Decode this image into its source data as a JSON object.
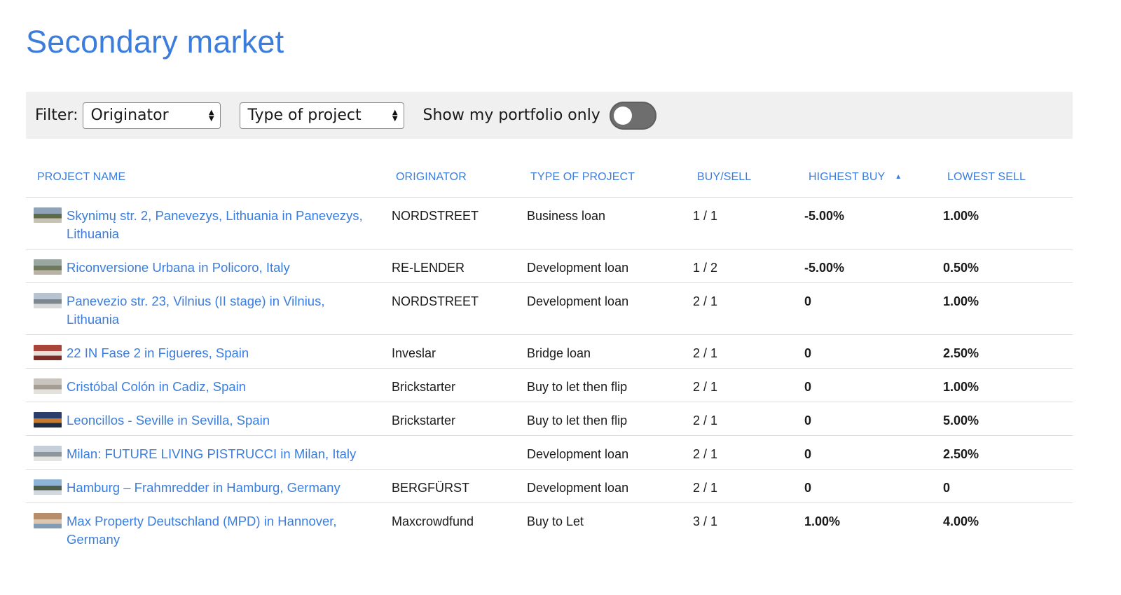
{
  "page": {
    "title": "Secondary market"
  },
  "filters": {
    "label": "Filter:",
    "originator": "Originator",
    "type_of_project": "Type of project",
    "portfolio_label": "Show my portfolio only",
    "portfolio_only": false
  },
  "table": {
    "columns": [
      "PROJECT NAME",
      "ORIGINATOR",
      "TYPE OF PROJECT",
      "BUY/SELL",
      "HIGHEST BUY",
      "LOWEST SELL"
    ],
    "sorted_by": "HIGHEST BUY",
    "rows": [
      {
        "name": "Skynimų str. 2, Panevezys, Lithuania in Panevezys, Lithuania",
        "originator": "NORDSTREET",
        "type": "Business loan",
        "buy_sell": "1 / 1",
        "highest_buy": "-5.00%",
        "lowest_sell": "1.00%",
        "thumb_colors": [
          "#8fa3b8",
          "#5d6b4a",
          "#c9c2b3"
        ]
      },
      {
        "name": "Riconversione Urbana in Policoro, Italy",
        "originator": "RE-LENDER",
        "type": "Development loan",
        "buy_sell": "1 / 2",
        "highest_buy": "-5.00%",
        "lowest_sell": "0.50%",
        "thumb_colors": [
          "#9aa7a0",
          "#6f7a5c",
          "#b9b3a4"
        ]
      },
      {
        "name": "Panevezio str. 23, Vilnius (II stage) in Vilnius, Lithuania",
        "originator": "NORDSTREET",
        "type": "Development loan",
        "buy_sell": "2 / 1",
        "highest_buy": "0",
        "lowest_sell": "1.00%",
        "thumb_colors": [
          "#b7c3cf",
          "#7d8790",
          "#d8d8d8"
        ]
      },
      {
        "name": "22 IN Fase 2 in Figueres, Spain",
        "originator": "Inveslar",
        "type": "Bridge loan",
        "buy_sell": "2 / 1",
        "highest_buy": "0",
        "lowest_sell": "2.50%",
        "thumb_colors": [
          "#a8443a",
          "#e6e0d8",
          "#7a2c25"
        ]
      },
      {
        "name": "Cristóbal Colón in Cadiz, Spain",
        "originator": "Brickstarter",
        "type": "Buy to let then flip",
        "buy_sell": "2 / 1",
        "highest_buy": "0",
        "lowest_sell": "1.00%",
        "thumb_colors": [
          "#c9c4bd",
          "#a39d94",
          "#e4e0da"
        ]
      },
      {
        "name": "Leoncillos - Seville in Sevilla, Spain",
        "originator": "Brickstarter",
        "type": "Buy to let then flip",
        "buy_sell": "2 / 1",
        "highest_buy": "0",
        "lowest_sell": "5.00%",
        "thumb_colors": [
          "#2b3d6b",
          "#c77a2e",
          "#1f2a44"
        ]
      },
      {
        "name": "Milan: FUTURE LIVING PISTRUCCI in Milan, Italy",
        "originator": "",
        "type": "Development loan",
        "buy_sell": "2 / 1",
        "highest_buy": "0",
        "lowest_sell": "2.50%",
        "thumb_colors": [
          "#c4cfd9",
          "#8e959b",
          "#e3e3e0"
        ]
      },
      {
        "name": "Hamburg – Frahmredder in Hamburg, Germany",
        "originator": "BERGFÜRST",
        "type": "Development loan",
        "buy_sell": "2 / 1",
        "highest_buy": "0",
        "lowest_sell": "0",
        "thumb_colors": [
          "#8fb3d6",
          "#4f5d4a",
          "#cfd8de"
        ]
      },
      {
        "name": "Max Property Deutschland (MPD) in Hannover, Germany",
        "originator": "Maxcrowdfund",
        "type": "Buy to Let",
        "buy_sell": "3 / 1",
        "highest_buy": "1.00%",
        "lowest_sell": "4.00%",
        "thumb_colors": [
          "#b88d6b",
          "#d9c7b4",
          "#7f9bb5"
        ]
      }
    ]
  }
}
